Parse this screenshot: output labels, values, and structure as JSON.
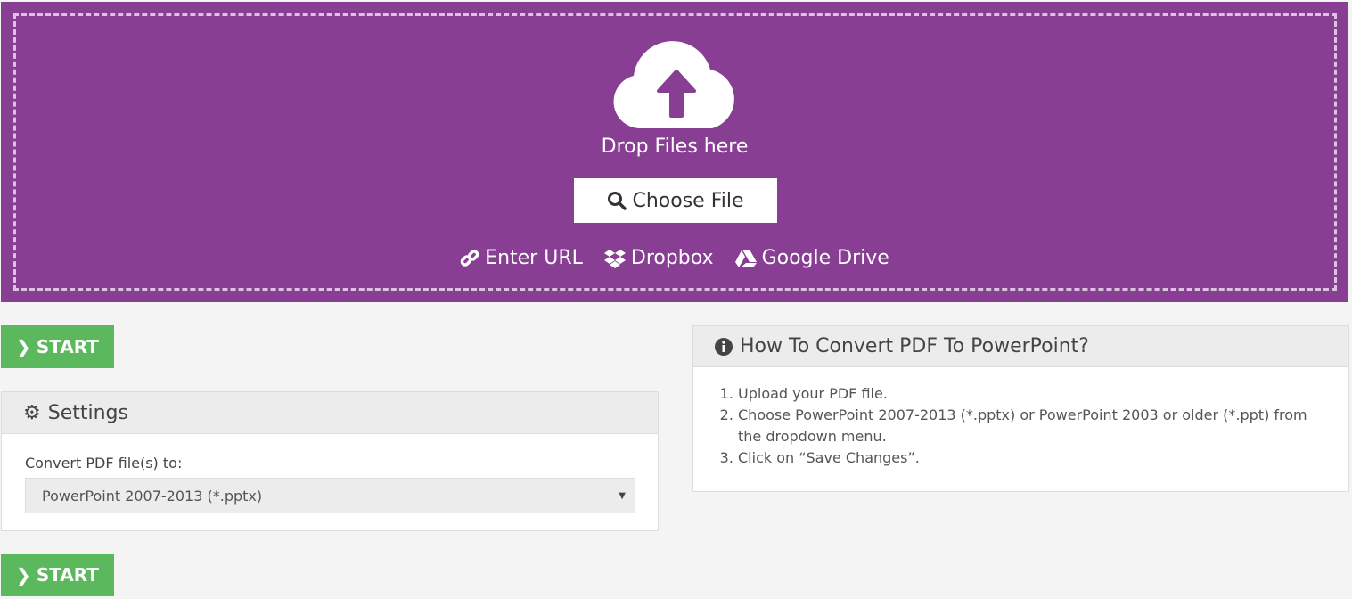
{
  "upload": {
    "drop_text": "Drop Files here",
    "choose_label": "Choose File",
    "links": [
      "Enter URL",
      "Dropbox",
      "Google Drive"
    ],
    "bg_color": "#873e93"
  },
  "start_label": "START",
  "start_color": "#5cb85c",
  "settings": {
    "title": "Settings",
    "field_label": "Convert PDF file(s) to:",
    "selected": "PowerPoint 2007-2013 (*.pptx)"
  },
  "howto": {
    "title": "How To Convert PDF To PowerPoint?",
    "steps": [
      "Upload your PDF file.",
      "Choose PowerPoint 2007-2013 (*.pptx) or PowerPoint 2003 or older (*.ppt) from the dropdown menu.",
      "Click on “Save Changes”."
    ]
  }
}
